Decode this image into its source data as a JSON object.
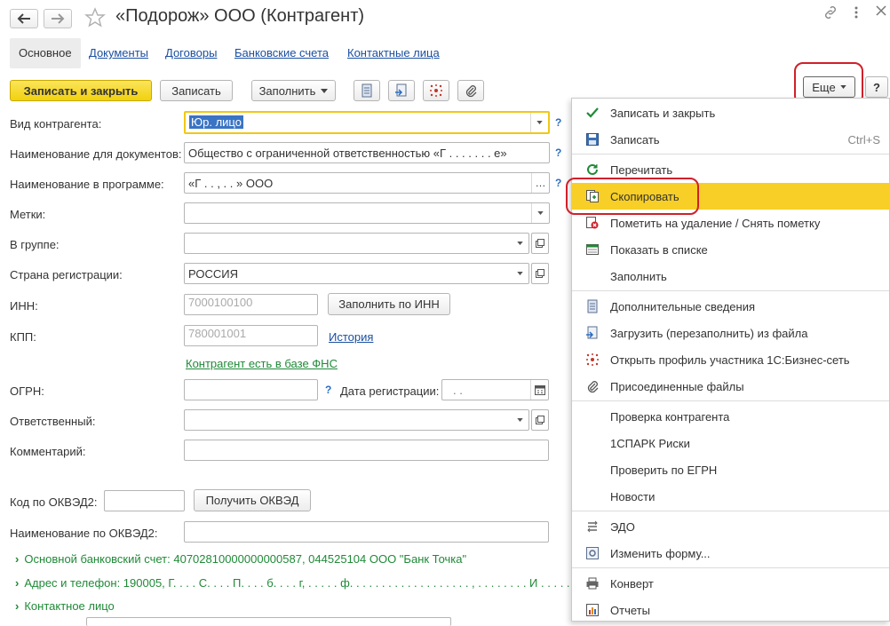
{
  "window": {
    "title": "«Подорож» ООО (Контрагент)"
  },
  "tabs": [
    {
      "label": "Основное"
    },
    {
      "label": "Документы"
    },
    {
      "label": "Договоры"
    },
    {
      "label": "Банковские счета"
    },
    {
      "label": "Контактные лица"
    }
  ],
  "toolbar": {
    "save_close": "Записать и закрыть",
    "save": "Записать",
    "fill": "Заполнить",
    "more": "Еще",
    "help": "?"
  },
  "form": {
    "kind": {
      "label": "Вид контрагента:",
      "value": "Юр. лицо"
    },
    "doc_name": {
      "label": "Наименование для документов:",
      "value": "Общество с ограниченной ответственностью «Г . . . . . . . е»"
    },
    "prog_name": {
      "label": "Наименование в программе:",
      "value": "«Г . . , . . » ООО"
    },
    "tags": {
      "label": "Метки:",
      "value": ""
    },
    "group": {
      "label": "В группе:",
      "value": ""
    },
    "country": {
      "label": "Страна регистрации:",
      "value": "РОССИЯ"
    },
    "inn": {
      "label": "ИНН:",
      "value": "7000100100",
      "button": "Заполнить по ИНН"
    },
    "kpp": {
      "label": "КПП:",
      "value": "780001001",
      "link": "История"
    },
    "fns_link": "Контрагент есть в базе ФНС",
    "ogrn": {
      "label": "ОГРН:",
      "value": ""
    },
    "reg_date": {
      "label": "Дата регистрации:",
      "value": ". ."
    },
    "responsible": {
      "label": "Ответственный:",
      "value": ""
    },
    "comment": {
      "label": "Комментарий:",
      "value": ""
    },
    "okved_code": {
      "label": "Код по ОКВЭД2:",
      "value": "",
      "button": "Получить ОКВЭД"
    },
    "okved_name": {
      "label": "Наименование по ОКВЭД2:",
      "value": ""
    }
  },
  "sections": {
    "bank": "Основной банковский счет: 40702810000000000587, 044525104 ООО \"Банк Точка\"",
    "address": "Адрес и телефон: 190005, Г. . . . С. . . . П. . . . б. . . . г, . . . . . ф. . . . . . . . . . . . . . . . . . . , . . . . . . . . И . . . . . . . . .",
    "contact": "Контактное лицо"
  },
  "menu": {
    "items": [
      {
        "label": "Записать и закрыть",
        "icon": "check-icon",
        "shortcut": ""
      },
      {
        "label": "Записать",
        "icon": "floppy-icon",
        "shortcut": "Ctrl+S"
      },
      {
        "label": "Перечитать",
        "icon": "refresh-icon",
        "shortcut": ""
      },
      {
        "label": "Скопировать",
        "icon": "copy-icon",
        "shortcut": ""
      },
      {
        "label": "Пометить на удаление / Снять пометку",
        "icon": "delete-mark-icon",
        "shortcut": ""
      },
      {
        "label": "Показать в списке",
        "icon": "list-icon",
        "shortcut": ""
      },
      {
        "label": "Заполнить",
        "icon": "",
        "shortcut": ""
      },
      {
        "label": "Дополнительные сведения",
        "icon": "info-sheet-icon",
        "shortcut": ""
      },
      {
        "label": "Загрузить (перезаполнить) из файла",
        "icon": "load-file-icon",
        "shortcut": ""
      },
      {
        "label": "Открыть профиль участника 1С:Бизнес-сеть",
        "icon": "network-icon",
        "shortcut": ""
      },
      {
        "label": "Присоединенные файлы",
        "icon": "paperclip-icon",
        "shortcut": ""
      },
      {
        "label": "Проверка контрагента",
        "icon": "",
        "shortcut": ""
      },
      {
        "label": "1СПАРК Риски",
        "icon": "",
        "shortcut": ""
      },
      {
        "label": "Проверить по ЕГРН",
        "icon": "",
        "shortcut": ""
      },
      {
        "label": "Новости",
        "icon": "",
        "shortcut": ""
      },
      {
        "label": "ЭДО",
        "icon": "edo-icon",
        "shortcut": ""
      },
      {
        "label": "Изменить форму...",
        "icon": "form-settings-icon",
        "shortcut": ""
      },
      {
        "label": "Конверт",
        "icon": "printer-icon",
        "shortcut": ""
      },
      {
        "label": "Отчеты",
        "icon": "reports-icon",
        "shortcut": ""
      }
    ]
  },
  "colors": {
    "accent_yellow": "#f8cf26",
    "link_blue": "#1a4fa0",
    "green_link": "#1f8a37",
    "highlight_ring": "#d0202a"
  }
}
